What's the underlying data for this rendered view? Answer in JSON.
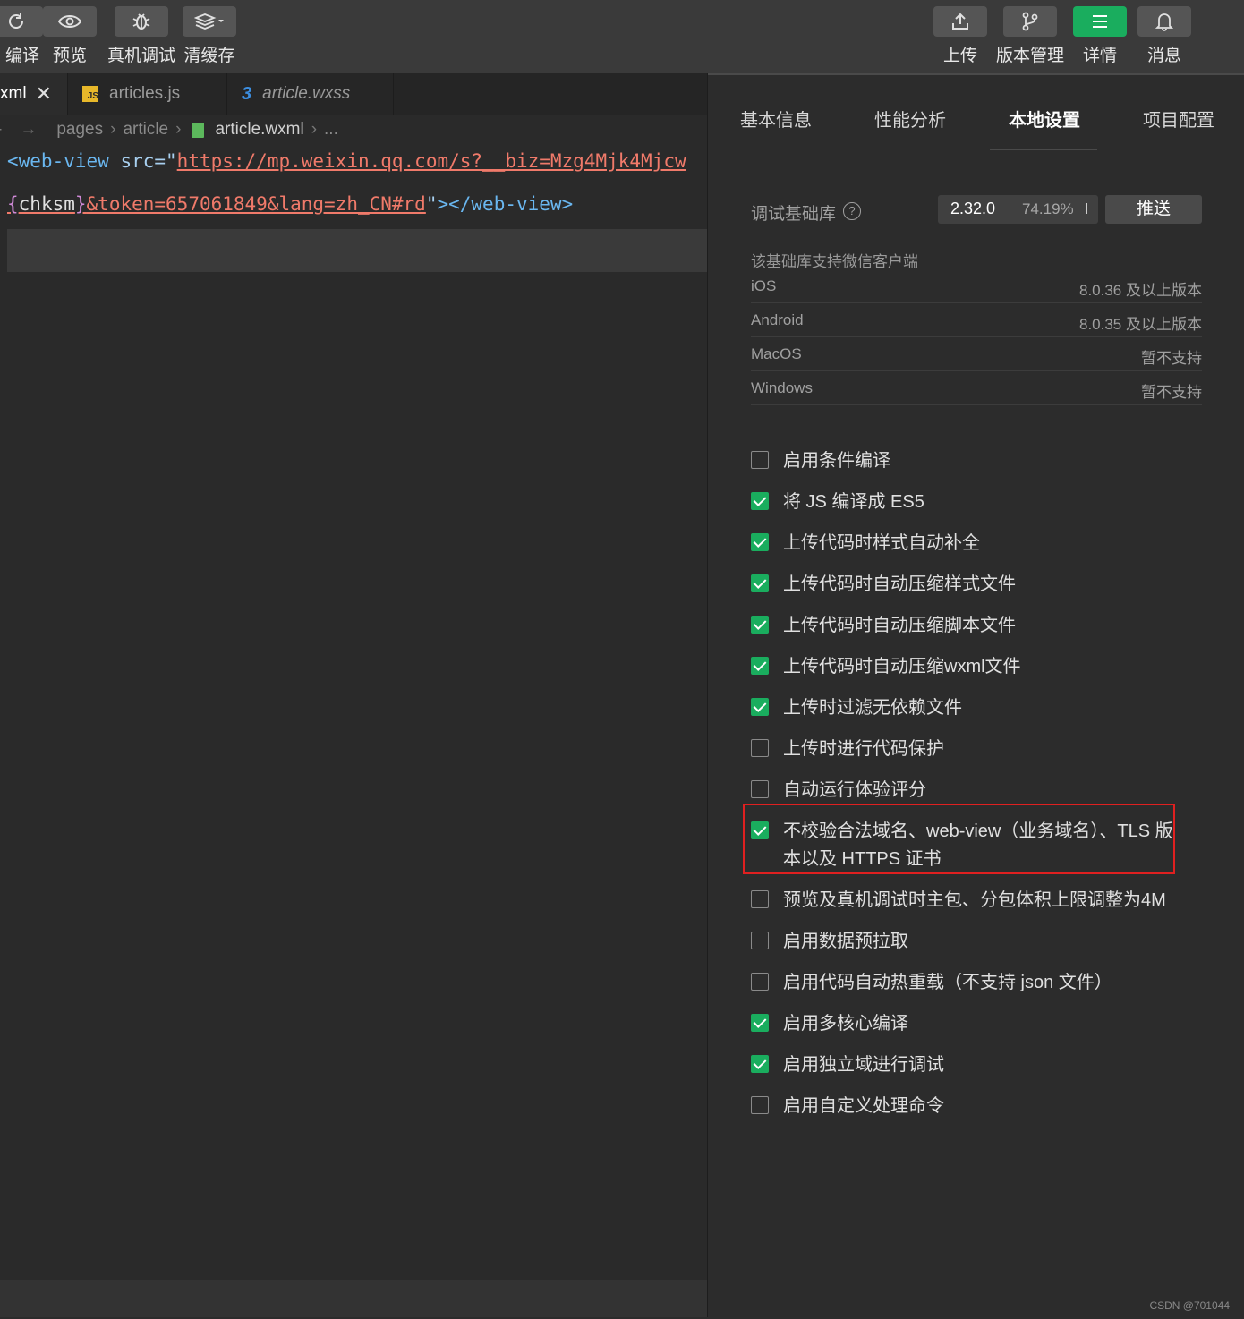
{
  "toolbar": {
    "left": [
      {
        "label": "编译",
        "icon": "refresh-icon"
      },
      {
        "label": "预览",
        "icon": "eye-icon"
      },
      {
        "label": "真机调试",
        "icon": "bug-icon"
      },
      {
        "label": "清缓存",
        "icon": "layers-icon"
      }
    ],
    "right": [
      {
        "label": "上传",
        "icon": "upload-icon"
      },
      {
        "label": "版本管理",
        "icon": "branch-icon"
      },
      {
        "label": "详情",
        "icon": "menu-icon"
      },
      {
        "label": "消息",
        "icon": "bell-icon"
      }
    ]
  },
  "editor": {
    "tabs": [
      {
        "label": "xml"
      },
      {
        "label": "articles.js",
        "icon": "js-file-icon"
      },
      {
        "label": "article.wxss",
        "icon": "css-file-icon"
      }
    ],
    "breadcrumb": [
      "pages",
      "article",
      "article.wxml",
      "..."
    ],
    "code": {
      "line1_tag_open": "<web-view",
      "line1_attr": " src=",
      "line1_quote": "\"",
      "line1_url": "https://mp.weixin.qq.com/s?__biz=Mzg4Mjk4Mjcw",
      "line2_brace_open": "{",
      "line2_var": "chksm",
      "line2_brace_close": "}",
      "line2_rest": "&token=657061849&lang=zh_CN#rd",
      "line2_quote": "\"",
      "line2_tag_close": "></web-view>"
    }
  },
  "panel": {
    "tabs": [
      "基本信息",
      "性能分析",
      "本地设置",
      "项目配置"
    ],
    "active_tab": "本地设置",
    "lib_label": "调试基础库",
    "lib_help": "?",
    "lib_version": "2.32.0",
    "lib_percent": "74.19%",
    "push_label": "推送",
    "support_title": "该基础库支持微信客户端",
    "clients": [
      {
        "name": "iOS",
        "version": "8.0.36 及以上版本"
      },
      {
        "name": "Android",
        "version": "8.0.35 及以上版本"
      },
      {
        "name": "MacOS",
        "version": "暂不支持"
      },
      {
        "name": "Windows",
        "version": "暂不支持"
      }
    ],
    "options": [
      {
        "label": "启用条件编译",
        "checked": false
      },
      {
        "label": "将 JS 编译成 ES5",
        "checked": true
      },
      {
        "label": "上传代码时样式自动补全",
        "checked": true
      },
      {
        "label": "上传代码时自动压缩样式文件",
        "checked": true
      },
      {
        "label": "上传代码时自动压缩脚本文件",
        "checked": true
      },
      {
        "label": "上传代码时自动压缩wxml文件",
        "checked": true
      },
      {
        "label": "上传时过滤无依赖文件",
        "checked": true
      },
      {
        "label": "上传时进行代码保护",
        "checked": false
      },
      {
        "label": "自动运行体验评分",
        "checked": false
      },
      {
        "label": "不校验合法域名、web-view（业务域名）、TLS 版",
        "label2": "本以及 HTTPS 证书",
        "checked": true,
        "highlighted": true
      },
      {
        "label": "预览及真机调试时主包、分包体积上限调整为4M",
        "checked": false
      },
      {
        "label": "启用数据预拉取",
        "checked": false
      },
      {
        "label": "启用代码自动热重载（不支持 json 文件）",
        "checked": false
      },
      {
        "label": "启用多核心编译",
        "checked": true
      },
      {
        "label": "启用独立域进行调试",
        "checked": true
      },
      {
        "label": "启用自定义处理命令",
        "checked": false
      }
    ]
  },
  "watermark": "CSDN @701044",
  "colors": {
    "accent": "#1aad5e",
    "highlight_border": "#e02020"
  }
}
